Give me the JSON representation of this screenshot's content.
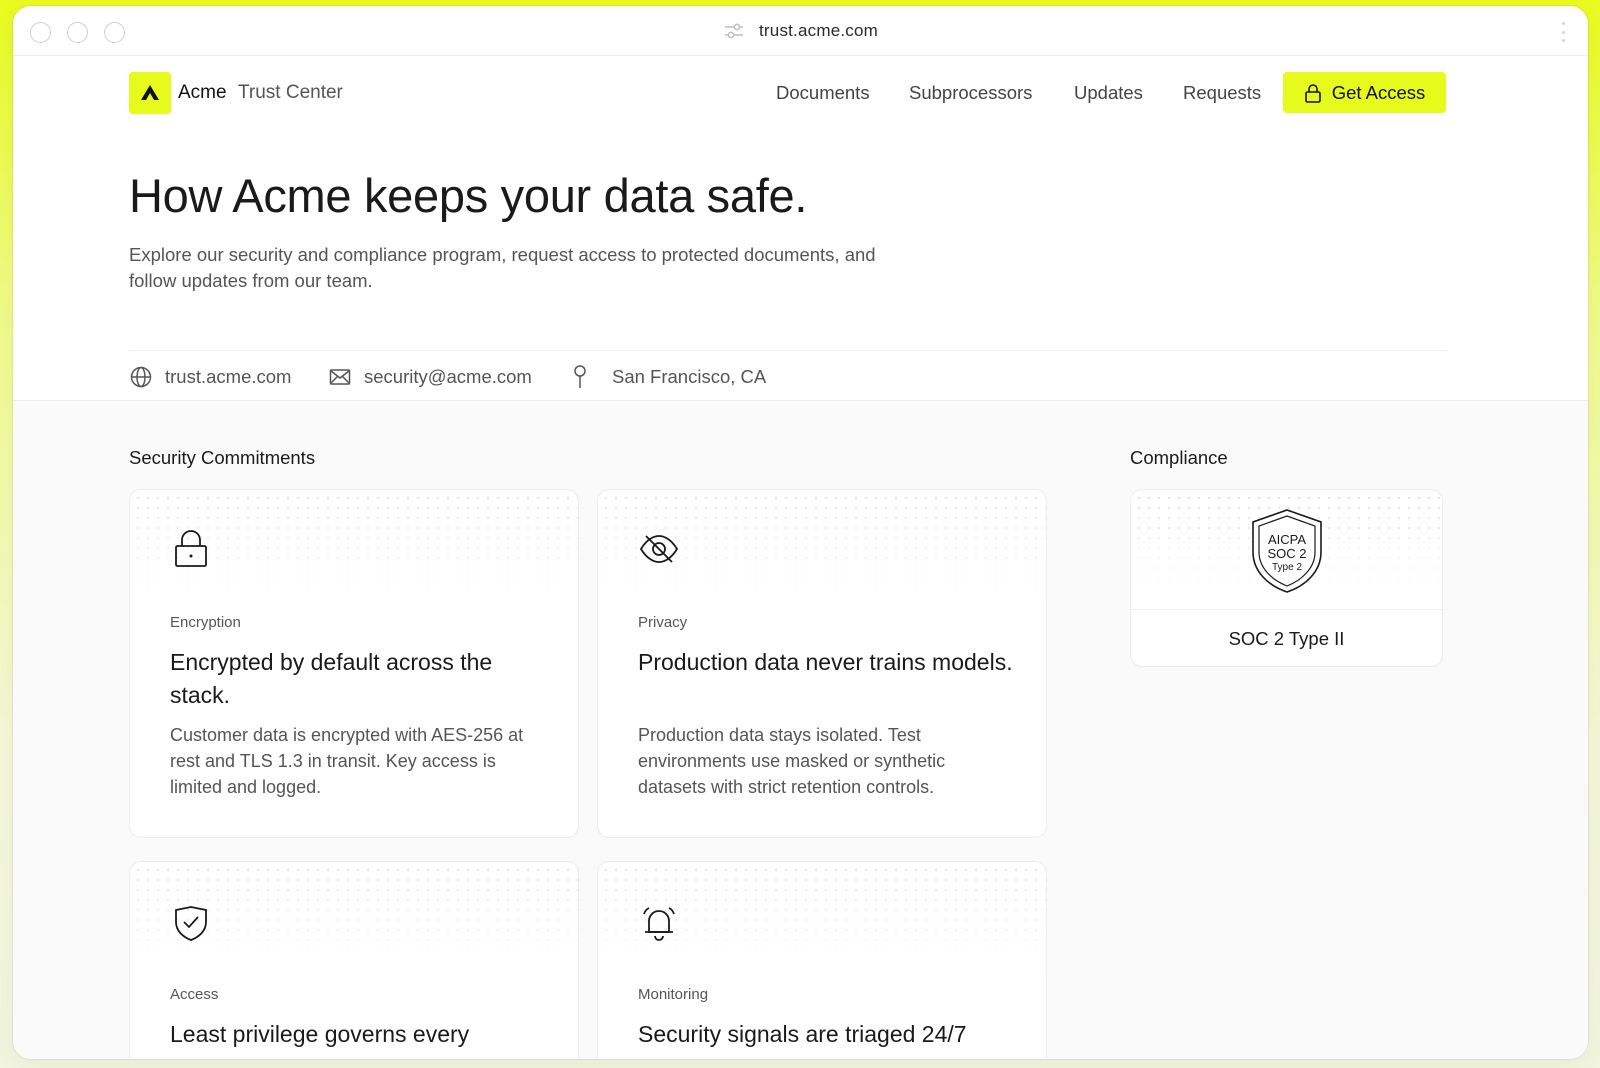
{
  "browser": {
    "url": "trust.acme.com"
  },
  "header": {
    "brand": "Acme",
    "brand_sub": "Trust Center",
    "nav": [
      "Documents",
      "Subprocessors",
      "Updates",
      "Requests"
    ],
    "cta_label": "Get Access"
  },
  "hero": {
    "title": "How Acme keeps your data safe.",
    "description": "Explore our security and compliance program, request access to protected documents, and follow updates from our team."
  },
  "contact": {
    "website": "trust.acme.com",
    "email": "security@acme.com",
    "location": "San Francisco, CA"
  },
  "commitments": {
    "title": "Security Commitments",
    "cards": [
      {
        "icon": "lock-icon",
        "category": "Encryption",
        "title": "Encrypted by default across the stack.",
        "body": "Customer data is encrypted with AES-256 at rest and TLS 1.3 in transit. Key access is limited and logged."
      },
      {
        "icon": "eye-off-icon",
        "category": "Privacy",
        "title": "Production data never trains models.",
        "body": "Production data stays isolated. Test environments use masked or synthetic datasets with strict retention controls."
      },
      {
        "icon": "shield-check-icon",
        "category": "Access",
        "title": "Least privilege governs every",
        "body": ""
      },
      {
        "icon": "alarm-bell-icon",
        "category": "Monitoring",
        "title": "Security signals are triaged 24/7",
        "body": ""
      }
    ]
  },
  "compliance": {
    "title": "Compliance",
    "badge_text": [
      "AICPA",
      "SOC 2",
      "Type 2"
    ],
    "label": "SOC 2 Type II"
  },
  "colors": {
    "accent": "#e6fb1c",
    "text": "#1a1a1a",
    "muted": "#555555"
  }
}
